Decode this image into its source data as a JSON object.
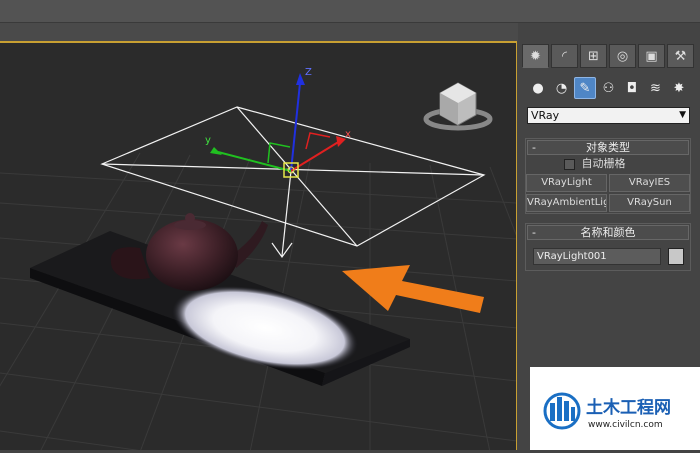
{
  "command_panel": {
    "tabs": [
      {
        "icon": "sun-icon",
        "glyph": "✹"
      },
      {
        "icon": "modify-curve-icon",
        "glyph": "◜"
      },
      {
        "icon": "hierarchy-icon",
        "glyph": "⊞"
      },
      {
        "icon": "motion-icon",
        "glyph": "◎"
      },
      {
        "icon": "display-icon",
        "glyph": "▣"
      },
      {
        "icon": "utilities-hammer-icon",
        "glyph": "⚒"
      }
    ],
    "subtype_icons": [
      {
        "icon": "geometry-sphere-icon",
        "glyph": "●"
      },
      {
        "icon": "shapes-icon",
        "glyph": "◔"
      },
      {
        "icon": "lights-icon",
        "glyph": "✎"
      },
      {
        "icon": "cameras-icon",
        "glyph": "⚇"
      },
      {
        "icon": "helpers-icon",
        "glyph": "◘"
      },
      {
        "icon": "space-warps-icon",
        "glyph": "≋"
      },
      {
        "icon": "systems-icon",
        "glyph": "✸"
      }
    ],
    "category_dropdown": {
      "value": "VRay"
    },
    "object_type": {
      "title": "对象类型",
      "collapse": "-",
      "autogrid_label": "自动栅格",
      "buttons": [
        "VRayLight",
        "VRayIES",
        "VRayAmbientLight",
        "VRaySun"
      ]
    },
    "name_color": {
      "title": "名称和颜色",
      "collapse": "-",
      "name_value": "VRayLight001",
      "color": "#c8c8c8"
    }
  },
  "gizmo": {
    "axis_z": "Z",
    "axis_y": "y",
    "axis_x": "x"
  },
  "colors": {
    "viewport_border": "#c8a032",
    "arrow": "#f07d1a",
    "axis_x": "#e02020",
    "axis_y": "#20c020",
    "axis_z": "#2030e0"
  },
  "watermark": {
    "title": "土木工程网",
    "url": "www.civilcn.com"
  }
}
